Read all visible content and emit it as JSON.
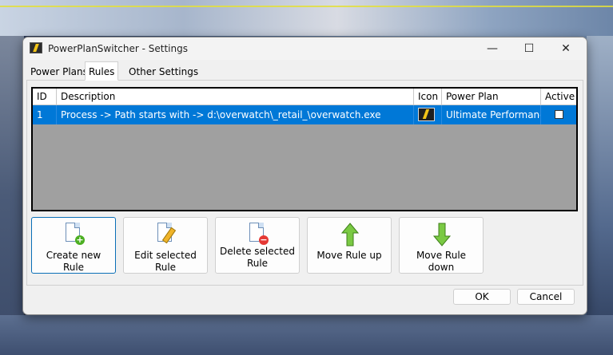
{
  "window": {
    "title": "PowerPlanSwitcher - Settings",
    "controls": {
      "minimize": "—",
      "maximize": "☐",
      "close": "✕"
    }
  },
  "tabs": [
    {
      "label": "Power Plans",
      "active": false
    },
    {
      "label": "Rules",
      "active": true
    },
    {
      "label": "Other Settings",
      "active": false
    }
  ],
  "table": {
    "columns": [
      "ID",
      "Description",
      "Icon",
      "Power Plan",
      "Active"
    ],
    "rows": [
      {
        "id": "1",
        "description": "Process -> Path starts with -> d:\\overwatch\\_retail_\\overwatch.exe",
        "icon": "power-plan-bolt-icon",
        "power_plan": "Ultimate Performance",
        "active": false
      }
    ]
  },
  "actions": [
    {
      "label": "Create new Rule",
      "icon": "document-add-icon"
    },
    {
      "label": "Edit selected Rule",
      "icon": "document-edit-icon"
    },
    {
      "label": "Delete selected Rule",
      "icon": "document-delete-icon"
    },
    {
      "label": "Move Rule up",
      "icon": "arrow-up-icon"
    },
    {
      "label": "Move Rule down",
      "icon": "arrow-down-icon"
    }
  ],
  "footer": {
    "ok": "OK",
    "cancel": "Cancel"
  },
  "colors": {
    "selection": "#0078d7",
    "grid_empty": "#a0a0a0",
    "accent_border": "#0a6fb7"
  }
}
